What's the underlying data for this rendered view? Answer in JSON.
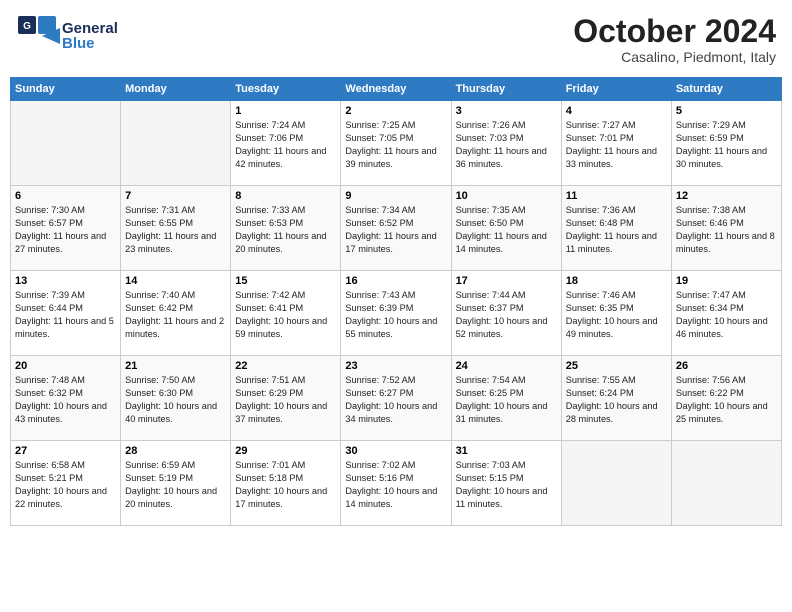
{
  "header": {
    "logo_line1": "General",
    "logo_line2": "Blue",
    "month": "October 2024",
    "location": "Casalino, Piedmont, Italy"
  },
  "columns": [
    "Sunday",
    "Monday",
    "Tuesday",
    "Wednesday",
    "Thursday",
    "Friday",
    "Saturday"
  ],
  "weeks": [
    [
      {
        "day": "",
        "info": ""
      },
      {
        "day": "",
        "info": ""
      },
      {
        "day": "1",
        "info": "Sunrise: 7:24 AM\nSunset: 7:06 PM\nDaylight: 11 hours and 42 minutes."
      },
      {
        "day": "2",
        "info": "Sunrise: 7:25 AM\nSunset: 7:05 PM\nDaylight: 11 hours and 39 minutes."
      },
      {
        "day": "3",
        "info": "Sunrise: 7:26 AM\nSunset: 7:03 PM\nDaylight: 11 hours and 36 minutes."
      },
      {
        "day": "4",
        "info": "Sunrise: 7:27 AM\nSunset: 7:01 PM\nDaylight: 11 hours and 33 minutes."
      },
      {
        "day": "5",
        "info": "Sunrise: 7:29 AM\nSunset: 6:59 PM\nDaylight: 11 hours and 30 minutes."
      }
    ],
    [
      {
        "day": "6",
        "info": "Sunrise: 7:30 AM\nSunset: 6:57 PM\nDaylight: 11 hours and 27 minutes."
      },
      {
        "day": "7",
        "info": "Sunrise: 7:31 AM\nSunset: 6:55 PM\nDaylight: 11 hours and 23 minutes."
      },
      {
        "day": "8",
        "info": "Sunrise: 7:33 AM\nSunset: 6:53 PM\nDaylight: 11 hours and 20 minutes."
      },
      {
        "day": "9",
        "info": "Sunrise: 7:34 AM\nSunset: 6:52 PM\nDaylight: 11 hours and 17 minutes."
      },
      {
        "day": "10",
        "info": "Sunrise: 7:35 AM\nSunset: 6:50 PM\nDaylight: 11 hours and 14 minutes."
      },
      {
        "day": "11",
        "info": "Sunrise: 7:36 AM\nSunset: 6:48 PM\nDaylight: 11 hours and 11 minutes."
      },
      {
        "day": "12",
        "info": "Sunrise: 7:38 AM\nSunset: 6:46 PM\nDaylight: 11 hours and 8 minutes."
      }
    ],
    [
      {
        "day": "13",
        "info": "Sunrise: 7:39 AM\nSunset: 6:44 PM\nDaylight: 11 hours and 5 minutes."
      },
      {
        "day": "14",
        "info": "Sunrise: 7:40 AM\nSunset: 6:42 PM\nDaylight: 11 hours and 2 minutes."
      },
      {
        "day": "15",
        "info": "Sunrise: 7:42 AM\nSunset: 6:41 PM\nDaylight: 10 hours and 59 minutes."
      },
      {
        "day": "16",
        "info": "Sunrise: 7:43 AM\nSunset: 6:39 PM\nDaylight: 10 hours and 55 minutes."
      },
      {
        "day": "17",
        "info": "Sunrise: 7:44 AM\nSunset: 6:37 PM\nDaylight: 10 hours and 52 minutes."
      },
      {
        "day": "18",
        "info": "Sunrise: 7:46 AM\nSunset: 6:35 PM\nDaylight: 10 hours and 49 minutes."
      },
      {
        "day": "19",
        "info": "Sunrise: 7:47 AM\nSunset: 6:34 PM\nDaylight: 10 hours and 46 minutes."
      }
    ],
    [
      {
        "day": "20",
        "info": "Sunrise: 7:48 AM\nSunset: 6:32 PM\nDaylight: 10 hours and 43 minutes."
      },
      {
        "day": "21",
        "info": "Sunrise: 7:50 AM\nSunset: 6:30 PM\nDaylight: 10 hours and 40 minutes."
      },
      {
        "day": "22",
        "info": "Sunrise: 7:51 AM\nSunset: 6:29 PM\nDaylight: 10 hours and 37 minutes."
      },
      {
        "day": "23",
        "info": "Sunrise: 7:52 AM\nSunset: 6:27 PM\nDaylight: 10 hours and 34 minutes."
      },
      {
        "day": "24",
        "info": "Sunrise: 7:54 AM\nSunset: 6:25 PM\nDaylight: 10 hours and 31 minutes."
      },
      {
        "day": "25",
        "info": "Sunrise: 7:55 AM\nSunset: 6:24 PM\nDaylight: 10 hours and 28 minutes."
      },
      {
        "day": "26",
        "info": "Sunrise: 7:56 AM\nSunset: 6:22 PM\nDaylight: 10 hours and 25 minutes."
      }
    ],
    [
      {
        "day": "27",
        "info": "Sunrise: 6:58 AM\nSunset: 5:21 PM\nDaylight: 10 hours and 22 minutes."
      },
      {
        "day": "28",
        "info": "Sunrise: 6:59 AM\nSunset: 5:19 PM\nDaylight: 10 hours and 20 minutes."
      },
      {
        "day": "29",
        "info": "Sunrise: 7:01 AM\nSunset: 5:18 PM\nDaylight: 10 hours and 17 minutes."
      },
      {
        "day": "30",
        "info": "Sunrise: 7:02 AM\nSunset: 5:16 PM\nDaylight: 10 hours and 14 minutes."
      },
      {
        "day": "31",
        "info": "Sunrise: 7:03 AM\nSunset: 5:15 PM\nDaylight: 10 hours and 11 minutes."
      },
      {
        "day": "",
        "info": ""
      },
      {
        "day": "",
        "info": ""
      }
    ]
  ]
}
